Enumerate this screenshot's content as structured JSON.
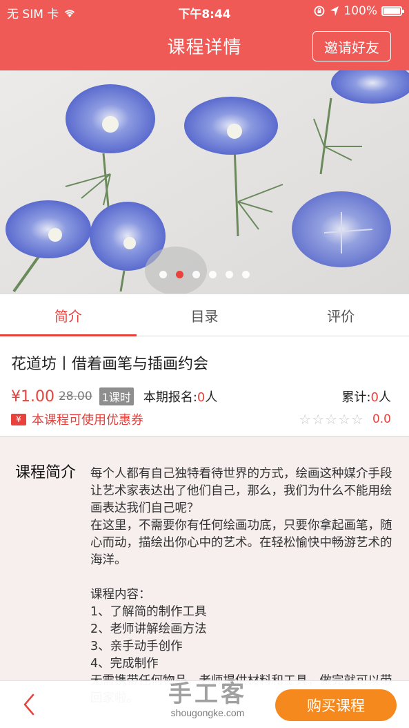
{
  "status_bar": {
    "carrier": "无 SIM 卡",
    "time": "下午8:44",
    "battery": "100%",
    "battery_level": 1.0
  },
  "header": {
    "title": "课程详情",
    "invite_label": "邀请好友"
  },
  "banner": {
    "dot_count": 6,
    "active_dot": 1
  },
  "tabs": [
    {
      "label": "简介",
      "active": true
    },
    {
      "label": "目录",
      "active": false
    },
    {
      "label": "评价",
      "active": false
    }
  ],
  "course": {
    "title": "花道坊丨借着画笔与插画约会",
    "price": "¥1.00",
    "original_price": "28.00",
    "lesson_badge": "1课时",
    "enroll_label": "本期报名:",
    "enroll_count": "0",
    "enroll_unit": "人",
    "total_label": "累计:",
    "total_count": "0",
    "total_unit": "人",
    "coupon_icon_text": "¥",
    "coupon_text": "本课程可使用优惠券",
    "stars": "☆☆☆☆☆",
    "rating_stars": 0,
    "rating": "0.0"
  },
  "intro": {
    "label": "课程简介",
    "text": "每个人都有自己独特看待世界的方式，绘画这种媒介手段让艺术家表达出了他们自己，那么，我们为什么不能用绘画表达我们自己呢？\n在这里，不需要你有任何绘画功底，只要你拿起画笔，随心而动，描绘出你心中的艺术。在轻松愉快中畅游艺术的海洋。\n\n课程内容：\n1、了解简的制作工具\n2、老师讲解绘画方法\n3、亲手动手创作\n4、完成制作\n无需携带任何物品，老师提供材料和工具，做完就可以带回家啦。"
  },
  "bottom": {
    "buy_label": "购买课程"
  },
  "watermark": {
    "main": "手工客",
    "sub": "shougongke.com"
  },
  "colors": {
    "accent": "#ef5a56",
    "price_red": "#e8423d",
    "buy_orange": "#f6891e",
    "intro_bg": "#f7eeee"
  }
}
